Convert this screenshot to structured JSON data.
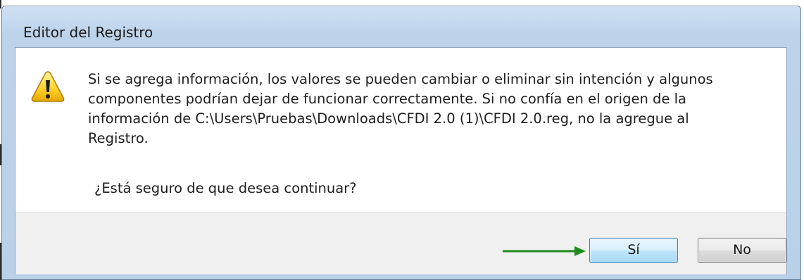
{
  "window": {
    "title": "Editor del Registro"
  },
  "dialog": {
    "icon": "warning-icon",
    "message_lines": [
      "Si se agrega información, los valores se pueden cambiar o eliminar sin intención y algunos",
      "componentes podrían dejar de funcionar correctamente. Si no confía en el origen de la",
      "información de C:\\Users\\Pruebas\\Downloads\\CFDI 2.0 (1)\\CFDI 2.0.reg, no la agregue al",
      "Registro."
    ],
    "question": "¿Está seguro de que desea continuar?"
  },
  "buttons": {
    "yes_label": "Sí",
    "no_label": "No"
  },
  "annotation": {
    "arrow_color": "#1e8a1e"
  },
  "colors": {
    "title_bar": "#bcd3ea",
    "footer": "#f0f0f0",
    "default_button_border": "#3c7fb1"
  }
}
